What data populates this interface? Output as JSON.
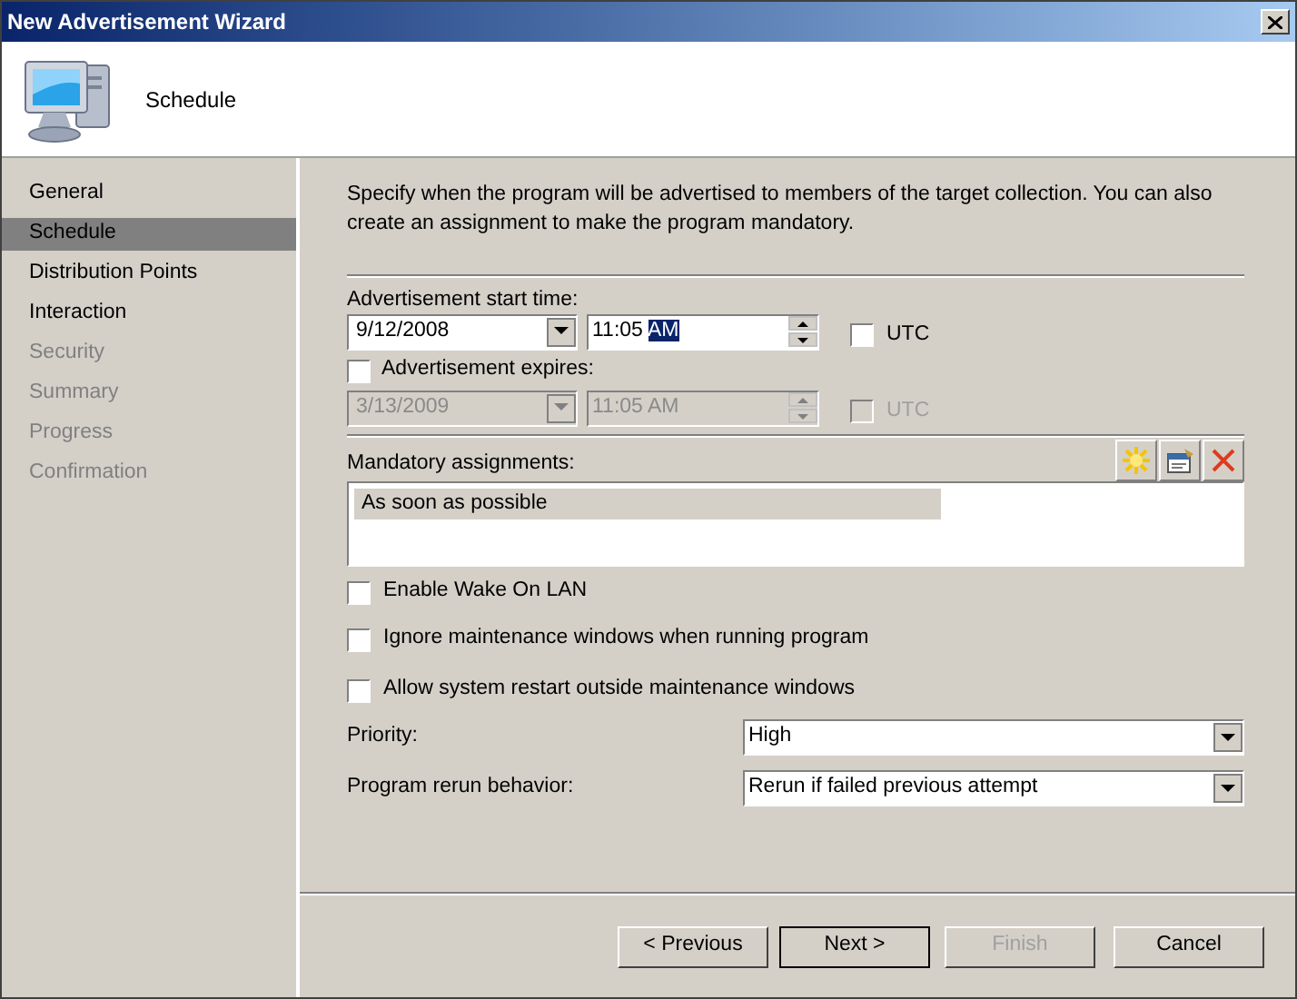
{
  "window": {
    "title": "New Advertisement Wizard"
  },
  "header": {
    "title": "Schedule"
  },
  "sidebar": {
    "items": [
      {
        "label": "General",
        "selected": false,
        "disabled": false
      },
      {
        "label": "Schedule",
        "selected": true,
        "disabled": false
      },
      {
        "label": "Distribution Points",
        "selected": false,
        "disabled": false
      },
      {
        "label": "Interaction",
        "selected": false,
        "disabled": false
      },
      {
        "label": "Security",
        "selected": false,
        "disabled": true
      },
      {
        "label": "Summary",
        "selected": false,
        "disabled": true
      },
      {
        "label": "Progress",
        "selected": false,
        "disabled": true
      },
      {
        "label": "Confirmation",
        "selected": false,
        "disabled": true
      }
    ]
  },
  "description": "Specify when the program will be advertised to members of the target collection. You can also create an assignment to make the program mandatory.",
  "start": {
    "label": "Advertisement start time:",
    "date": "9/12/2008",
    "time": "11:05",
    "time_selected": "AM",
    "utc": {
      "label": "UTC",
      "checked": false,
      "disabled": false
    },
    "disabled": false
  },
  "expires": {
    "label": "Advertisement expires:",
    "checked": false,
    "date": "3/13/2009",
    "time": "11:05 AM",
    "utc": {
      "label": "UTC",
      "checked": false,
      "disabled": true
    },
    "disabled": true
  },
  "mandatory": {
    "label": "Mandatory assignments:",
    "items": [
      {
        "text": "As soon as possible",
        "selected": true
      }
    ]
  },
  "options": [
    {
      "label": "Enable Wake On LAN",
      "checked": false
    },
    {
      "label": "Ignore maintenance windows when running program",
      "checked": false
    },
    {
      "label": "Allow system restart outside maintenance windows",
      "checked": false
    }
  ],
  "selects": [
    {
      "label": "Priority:",
      "value": "High"
    },
    {
      "label": "Program rerun behavior:",
      "value": "Rerun if failed previous attempt"
    }
  ],
  "buttons": [
    {
      "label": "< Previous",
      "disabled": false,
      "default": false
    },
    {
      "label": "Next >",
      "disabled": false,
      "default": true
    },
    {
      "label": "Finish",
      "disabled": true,
      "default": false
    },
    {
      "label": "Cancel",
      "disabled": false,
      "default": false
    }
  ]
}
